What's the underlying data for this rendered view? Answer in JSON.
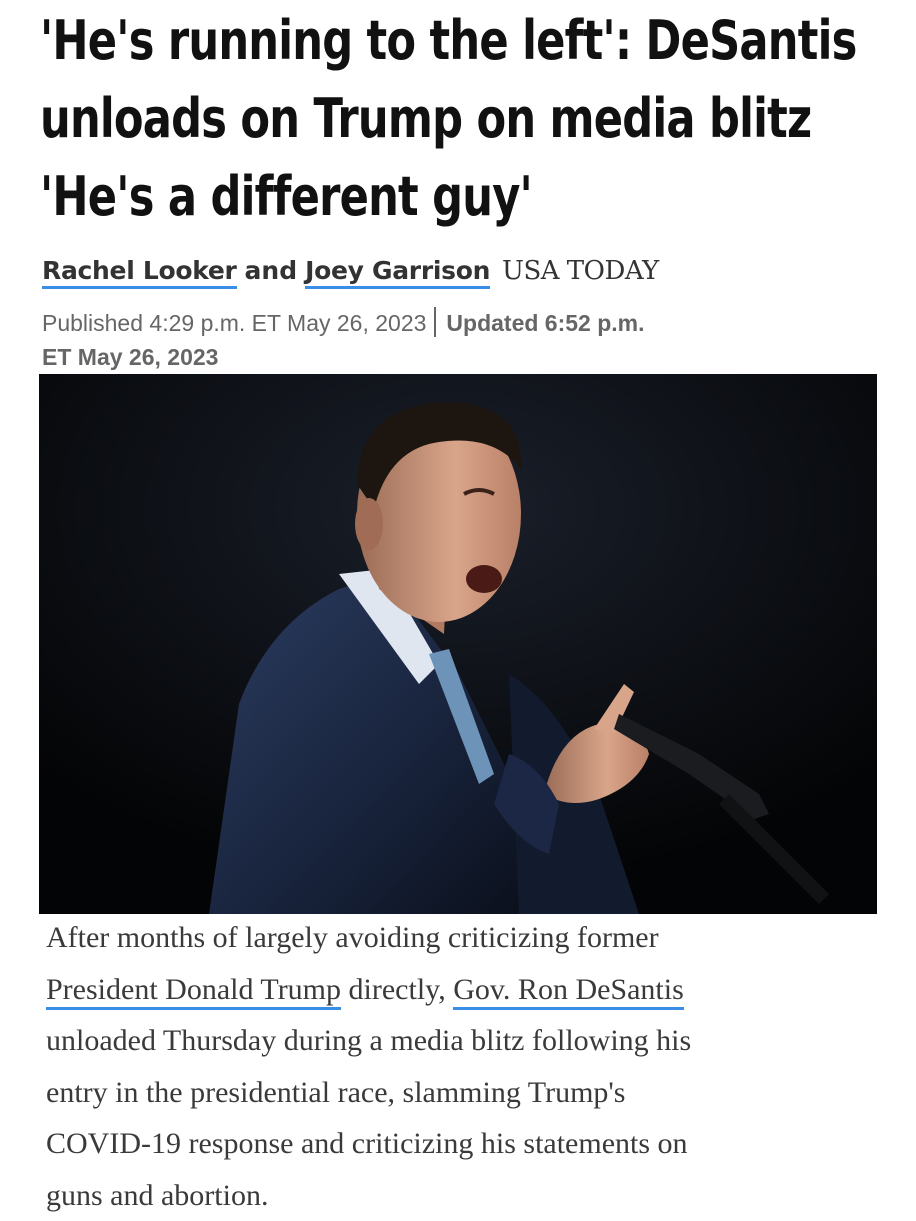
{
  "article": {
    "headline_lines": [
      "'He's running to the left': DeSantis",
      "unloads on Trump on media blitz",
      "'He's a different guy'"
    ],
    "authors": [
      "Rachel Looker",
      "Joey Garrison"
    ],
    "author_joiner": "and",
    "source": "USA TODAY",
    "published": "Published 4:29 p.m. ET May 26, 2023",
    "updated_line1": "Updated 6:52 p.m.",
    "updated_line2": "ET May 26, 2023",
    "photo_icon": "speaker-photo",
    "body": {
      "l1": "After months of largely avoiding criticizing former",
      "l2_link1": "President Donald Trump",
      "l2_mid": " directly, ",
      "l2_link2": "Gov. Ron DeSantis",
      "l3": "unloaded Thursday during a media blitz following his",
      "l4": "entry in the presidential race, slamming Trump's",
      "l5": "COVID-19 response and criticizing his statements on",
      "l6": "guns and abortion."
    }
  },
  "colors": {
    "link_underline": "#3a8ee6",
    "text": "#3a3a3a",
    "headline": "#111111"
  }
}
